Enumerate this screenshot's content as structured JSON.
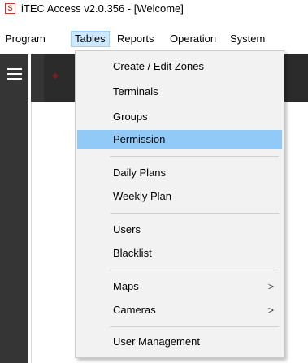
{
  "window": {
    "title": "iTEC Access v2.0.356 - [Welcome]",
    "icon": "app-logo-icon"
  },
  "menubar": {
    "items": [
      {
        "label": "Program"
      },
      {
        "label": "Tables"
      },
      {
        "label": "Reports"
      },
      {
        "label": "Operation"
      },
      {
        "label": "System"
      }
    ],
    "active": "Tables"
  },
  "tables_menu": {
    "items": [
      {
        "label": "Create / Edit Zones"
      },
      {
        "label": "Terminals"
      },
      {
        "label": "Groups"
      },
      {
        "label": "Permission"
      },
      {
        "label": "Daily Plans"
      },
      {
        "label": "Weekly Plan"
      },
      {
        "label": "Users"
      },
      {
        "label": "Blacklist"
      },
      {
        "label": "Maps",
        "submenu_arrow": ">"
      },
      {
        "label": "Cameras",
        "submenu_arrow": ">"
      },
      {
        "label": "User Management"
      }
    ],
    "highlighted": "Permission"
  },
  "colors": {
    "highlight": "#91c9f7",
    "active_menu": "#cce8ff",
    "rail": "#353535",
    "toolbar": "#2b2b2b"
  }
}
